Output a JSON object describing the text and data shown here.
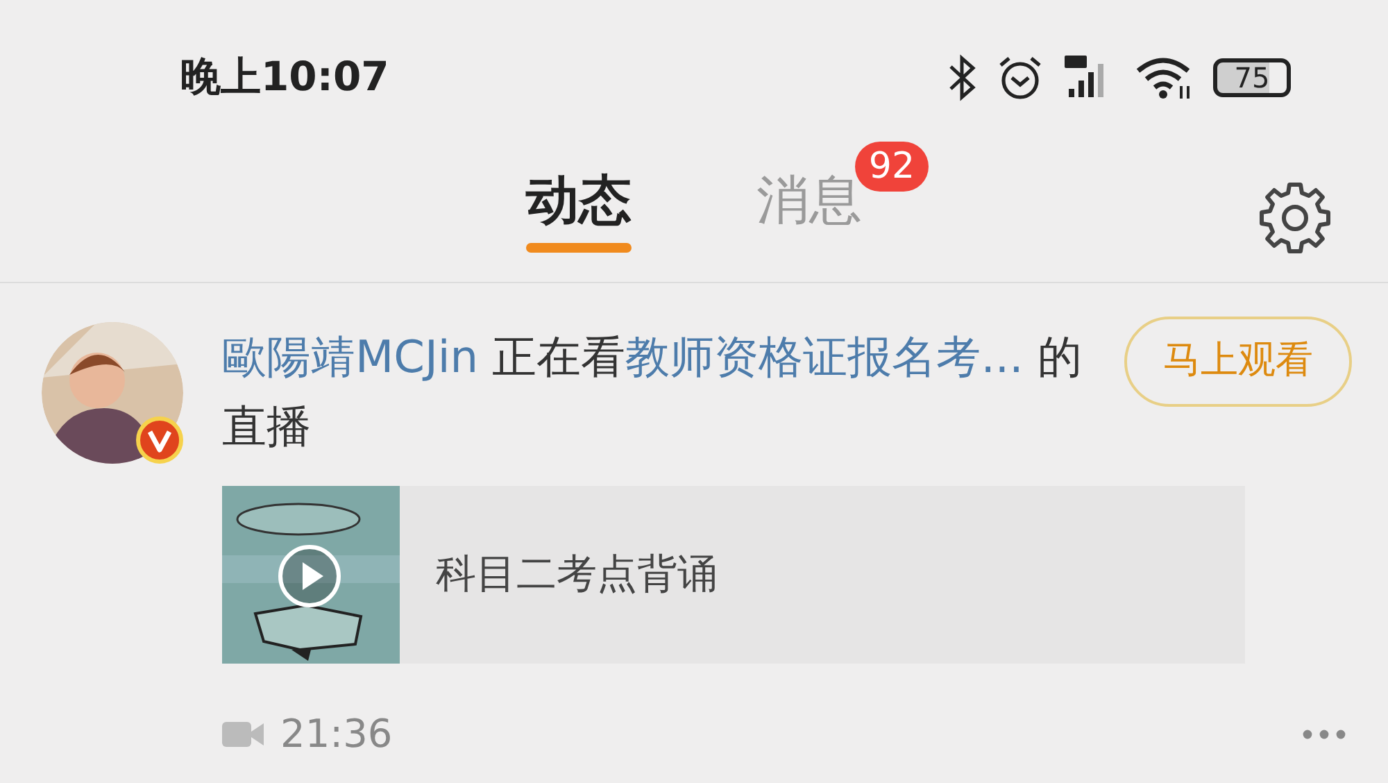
{
  "status_bar": {
    "time": "晚上10:07",
    "battery": "75"
  },
  "tabs": [
    {
      "label": "动态",
      "selected": true
    },
    {
      "label": "消息",
      "selected": false,
      "badge": "92"
    }
  ],
  "feed": [
    {
      "user": "歐陽靖MCJin",
      "verified": true,
      "action": "正在看",
      "target": "教师资格证报名考...",
      "suffix": "的直播",
      "button": "马上观看",
      "card": {
        "title": "科目二考点背诵"
      },
      "duration": "21:36"
    }
  ]
}
